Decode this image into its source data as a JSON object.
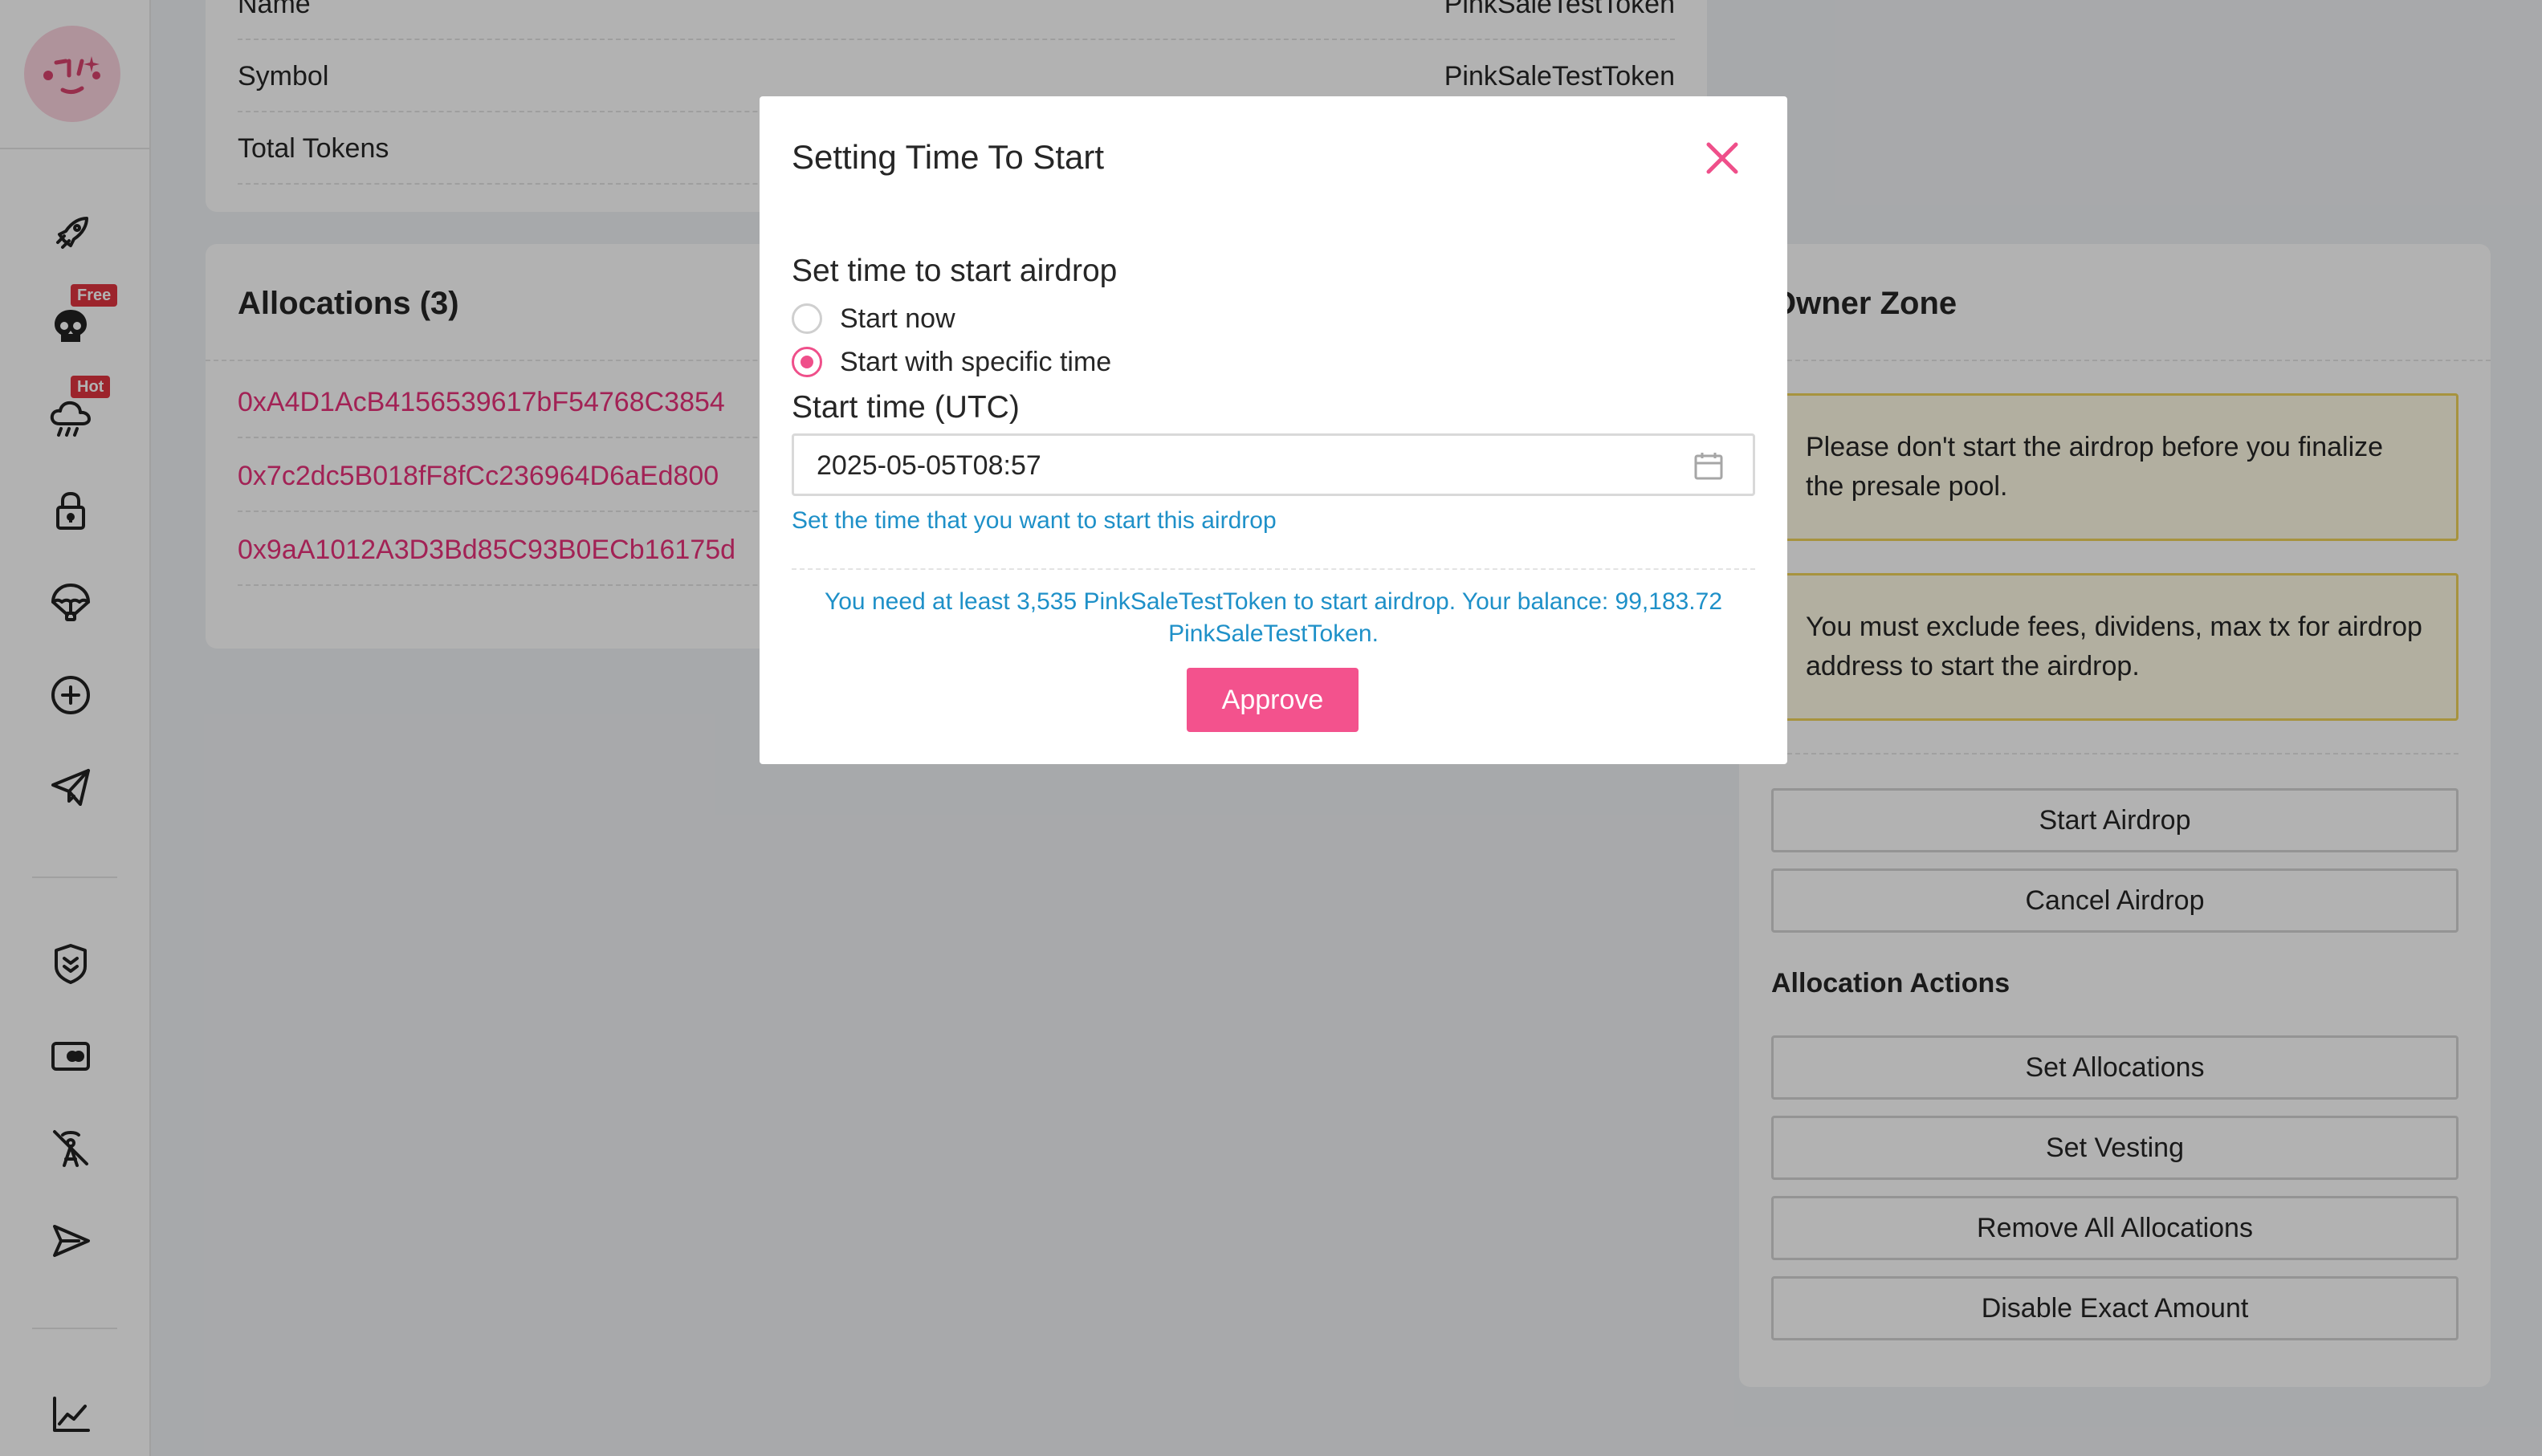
{
  "token_card": {
    "rows": [
      {
        "key": "Name",
        "value": "PinkSaleTestToken"
      },
      {
        "key": "Symbol",
        "value": "PinkSaleTestToken"
      },
      {
        "key": "Total Tokens",
        "value": ""
      }
    ]
  },
  "allocations": {
    "title": "Allocations (3)",
    "addresses": [
      "0xA4D1AcB4156539617bF54768C3854",
      "0x7c2dc5B018fF8fCc236964D6aEd800",
      "0x9aA1012A3D3Bd85C93B0ECb16175d"
    ]
  },
  "owner_zone": {
    "title": "Owner Zone",
    "alerts": [
      "Please don't start the airdrop before you finalize the presale pool.",
      "You must exclude fees, dividens, max tx for airdrop address to start the airdrop."
    ],
    "buttons": [
      "Start Airdrop",
      "Cancel Airdrop"
    ],
    "allocation_actions_title": "Allocation Actions",
    "allocation_buttons": [
      "Set Allocations",
      "Set Vesting",
      "Remove All Allocations",
      "Disable Exact Amount"
    ]
  },
  "sidebar": {
    "icons": [
      "rocket-icon",
      "skull-icon",
      "cloud-rain-icon",
      "lock-icon",
      "parachute-icon",
      "plus-circle-icon",
      "send-icon",
      "shield-icon",
      "wallet-icon",
      "no-antenna-icon",
      "send-arrow-icon",
      "chart-line-icon"
    ],
    "badges": {
      "free": "Free",
      "hot": "Hot"
    }
  },
  "modal": {
    "title": "Setting Time To Start",
    "set_time_label": "Set time to start airdrop",
    "options": [
      {
        "label": "Start now",
        "checked": false
      },
      {
        "label": "Start with specific time",
        "checked": true
      }
    ],
    "start_time_label": "Start time (UTC)",
    "start_time_value": "2025-05-05T08:57",
    "help_text": "Set the time that you want to start this airdrop",
    "notice_line1": "You need at least 3,535 PinkSaleTestToken to start airdrop. Your balance: 99,183.72",
    "notice_line2": "PinkSaleTestToken.",
    "approve_label": "Approve"
  },
  "colors": {
    "accent": "#f3528d",
    "link": "#e8317a",
    "info": "#1e90c8",
    "warning_bg": "#fffbe6",
    "warning_border": "#f0d35a"
  }
}
